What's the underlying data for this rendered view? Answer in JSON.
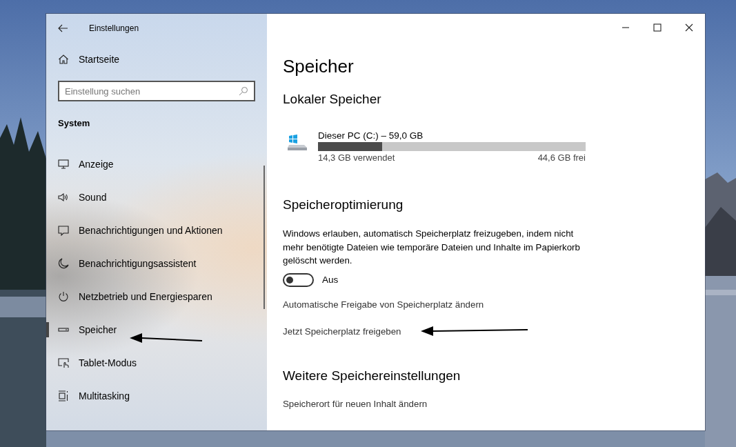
{
  "window": {
    "title": "Einstellungen"
  },
  "sidebar": {
    "home": "Startseite",
    "search": {
      "placeholder": "Einstellung suchen"
    },
    "section": "System",
    "items": [
      {
        "label": "Anzeige",
        "kind": "display",
        "selected": false
      },
      {
        "label": "Sound",
        "kind": "sound",
        "selected": false
      },
      {
        "label": "Benachrichtigungen und Aktionen",
        "kind": "notification",
        "selected": false
      },
      {
        "label": "Benachrichtigungsassistent",
        "kind": "moon",
        "selected": false
      },
      {
        "label": "Netzbetrieb und Energiesparen",
        "kind": "power",
        "selected": false
      },
      {
        "label": "Speicher",
        "kind": "storage",
        "selected": true
      },
      {
        "label": "Tablet-Modus",
        "kind": "tablet",
        "selected": false
      },
      {
        "label": "Multitasking",
        "kind": "multitask",
        "selected": false
      }
    ]
  },
  "content": {
    "title": "Speicher",
    "local": {
      "heading": "Lokaler Speicher",
      "drive": "Dieser PC (C:) – 59,0 GB",
      "level": 0.24,
      "used": "14,3 GB verwendet",
      "free": "44,6 GB frei"
    },
    "sense": {
      "heading": "Speicheroptimierung",
      "description": "Windows erlauben, automatisch Speicherplatz freizugeben, indem nicht mehr benötigte Dateien wie temporäre Dateien und Inhalte im Papierkorb gelöscht werden.",
      "toggle": {
        "on": false,
        "label": "Aus"
      },
      "links": [
        "Automatische Freigabe von Speicherplatz ändern",
        "Jetzt Speicherplatz freigeben"
      ]
    },
    "more": {
      "heading": "Weitere Speichereinstellungen",
      "links": [
        "Speicherort für neuen Inhalt ändern"
      ]
    }
  }
}
